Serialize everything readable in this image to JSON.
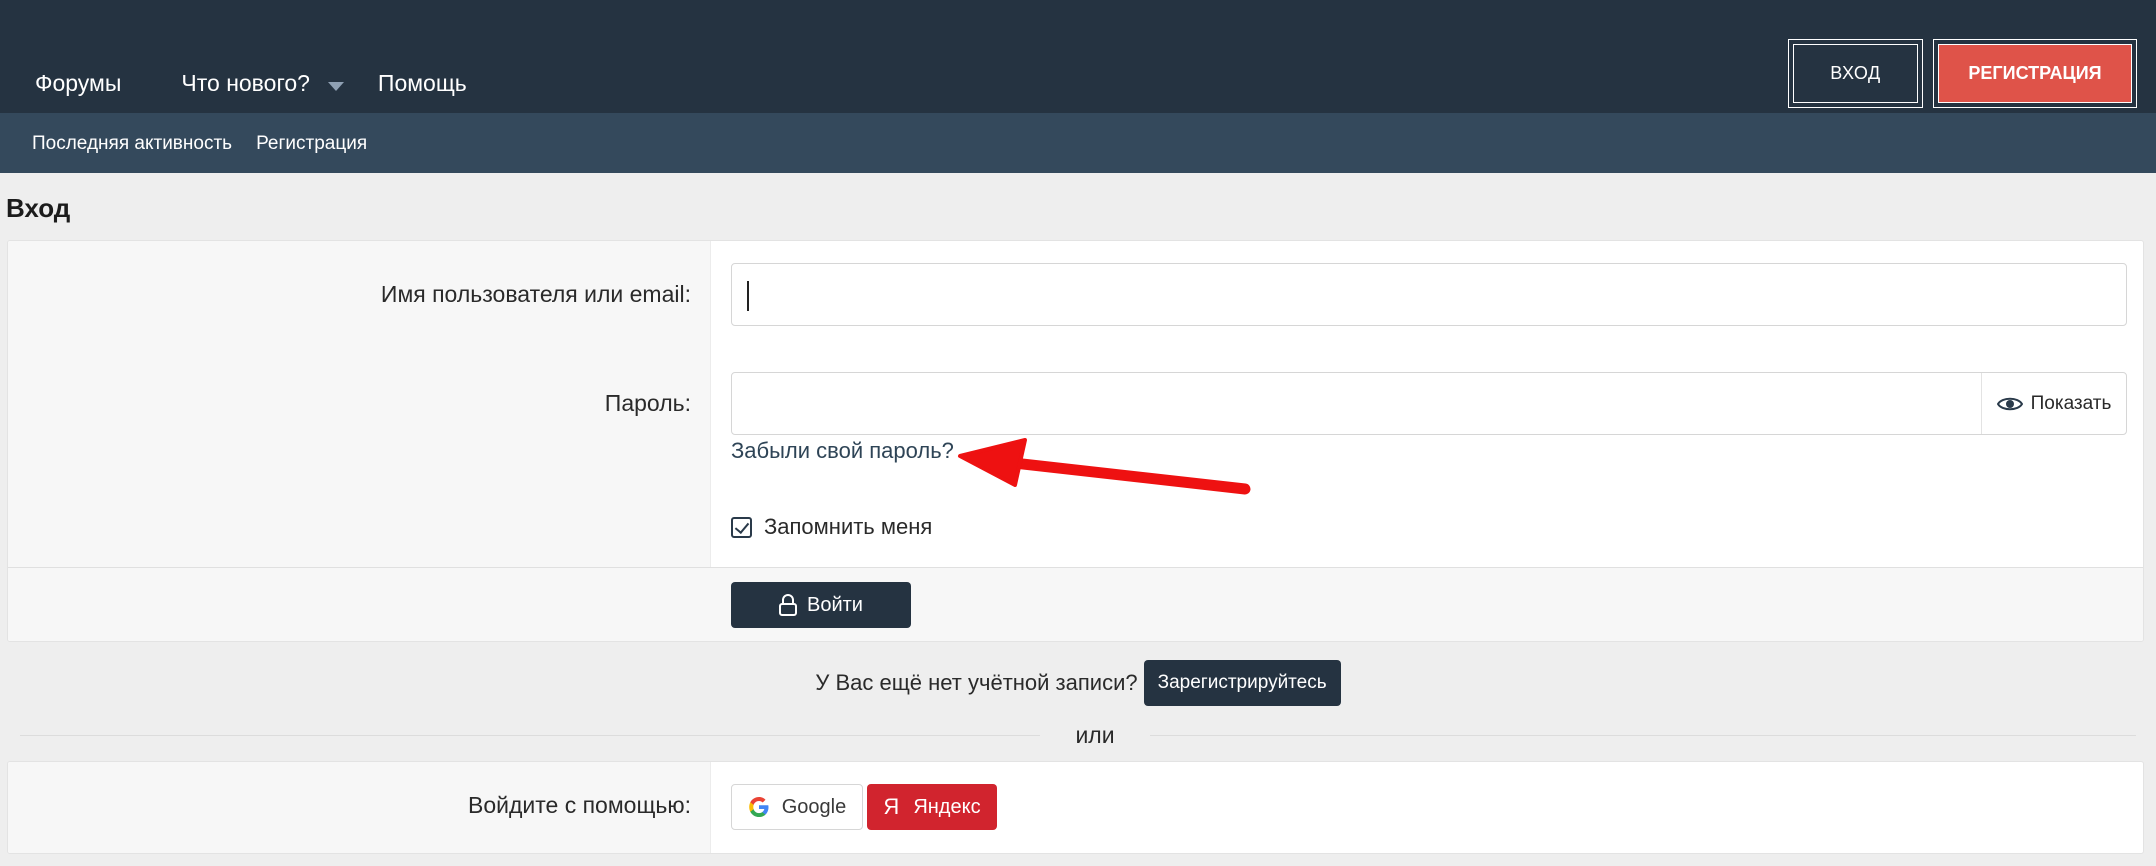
{
  "header": {
    "nav": [
      {
        "label": "Форумы"
      },
      {
        "label": "Что нового?"
      },
      {
        "label": "Помощь"
      }
    ],
    "login_button": "ВХОД",
    "register_button": "РЕГИСТРАЦИЯ",
    "accent_color": "#df5349"
  },
  "subnav": {
    "items": [
      "Последняя активность",
      "Регистрация"
    ]
  },
  "page": {
    "title": "Вход"
  },
  "login_form": {
    "username_label": "Имя пользователя или email:",
    "username_value": "",
    "password_label": "Пароль:",
    "password_value": "",
    "show_password": "Показать",
    "forgot_password": "Забыли свой пароль?",
    "remember_me": "Запомнить меня",
    "remember_checked": true,
    "submit": "Войти"
  },
  "signup_prompt": {
    "text": "У Вас ещё нет учётной записи?",
    "button": "Зарегистрируйтесь"
  },
  "divider": {
    "text": "или"
  },
  "social": {
    "label": "Войдите с помощью:",
    "google": "Google",
    "yandex": "Яндекс",
    "yandex_logo": "Я",
    "yandex_color": "#d1242e"
  },
  "annotation": {
    "icon": "red-arrow-icon",
    "color": "#ee1111"
  }
}
